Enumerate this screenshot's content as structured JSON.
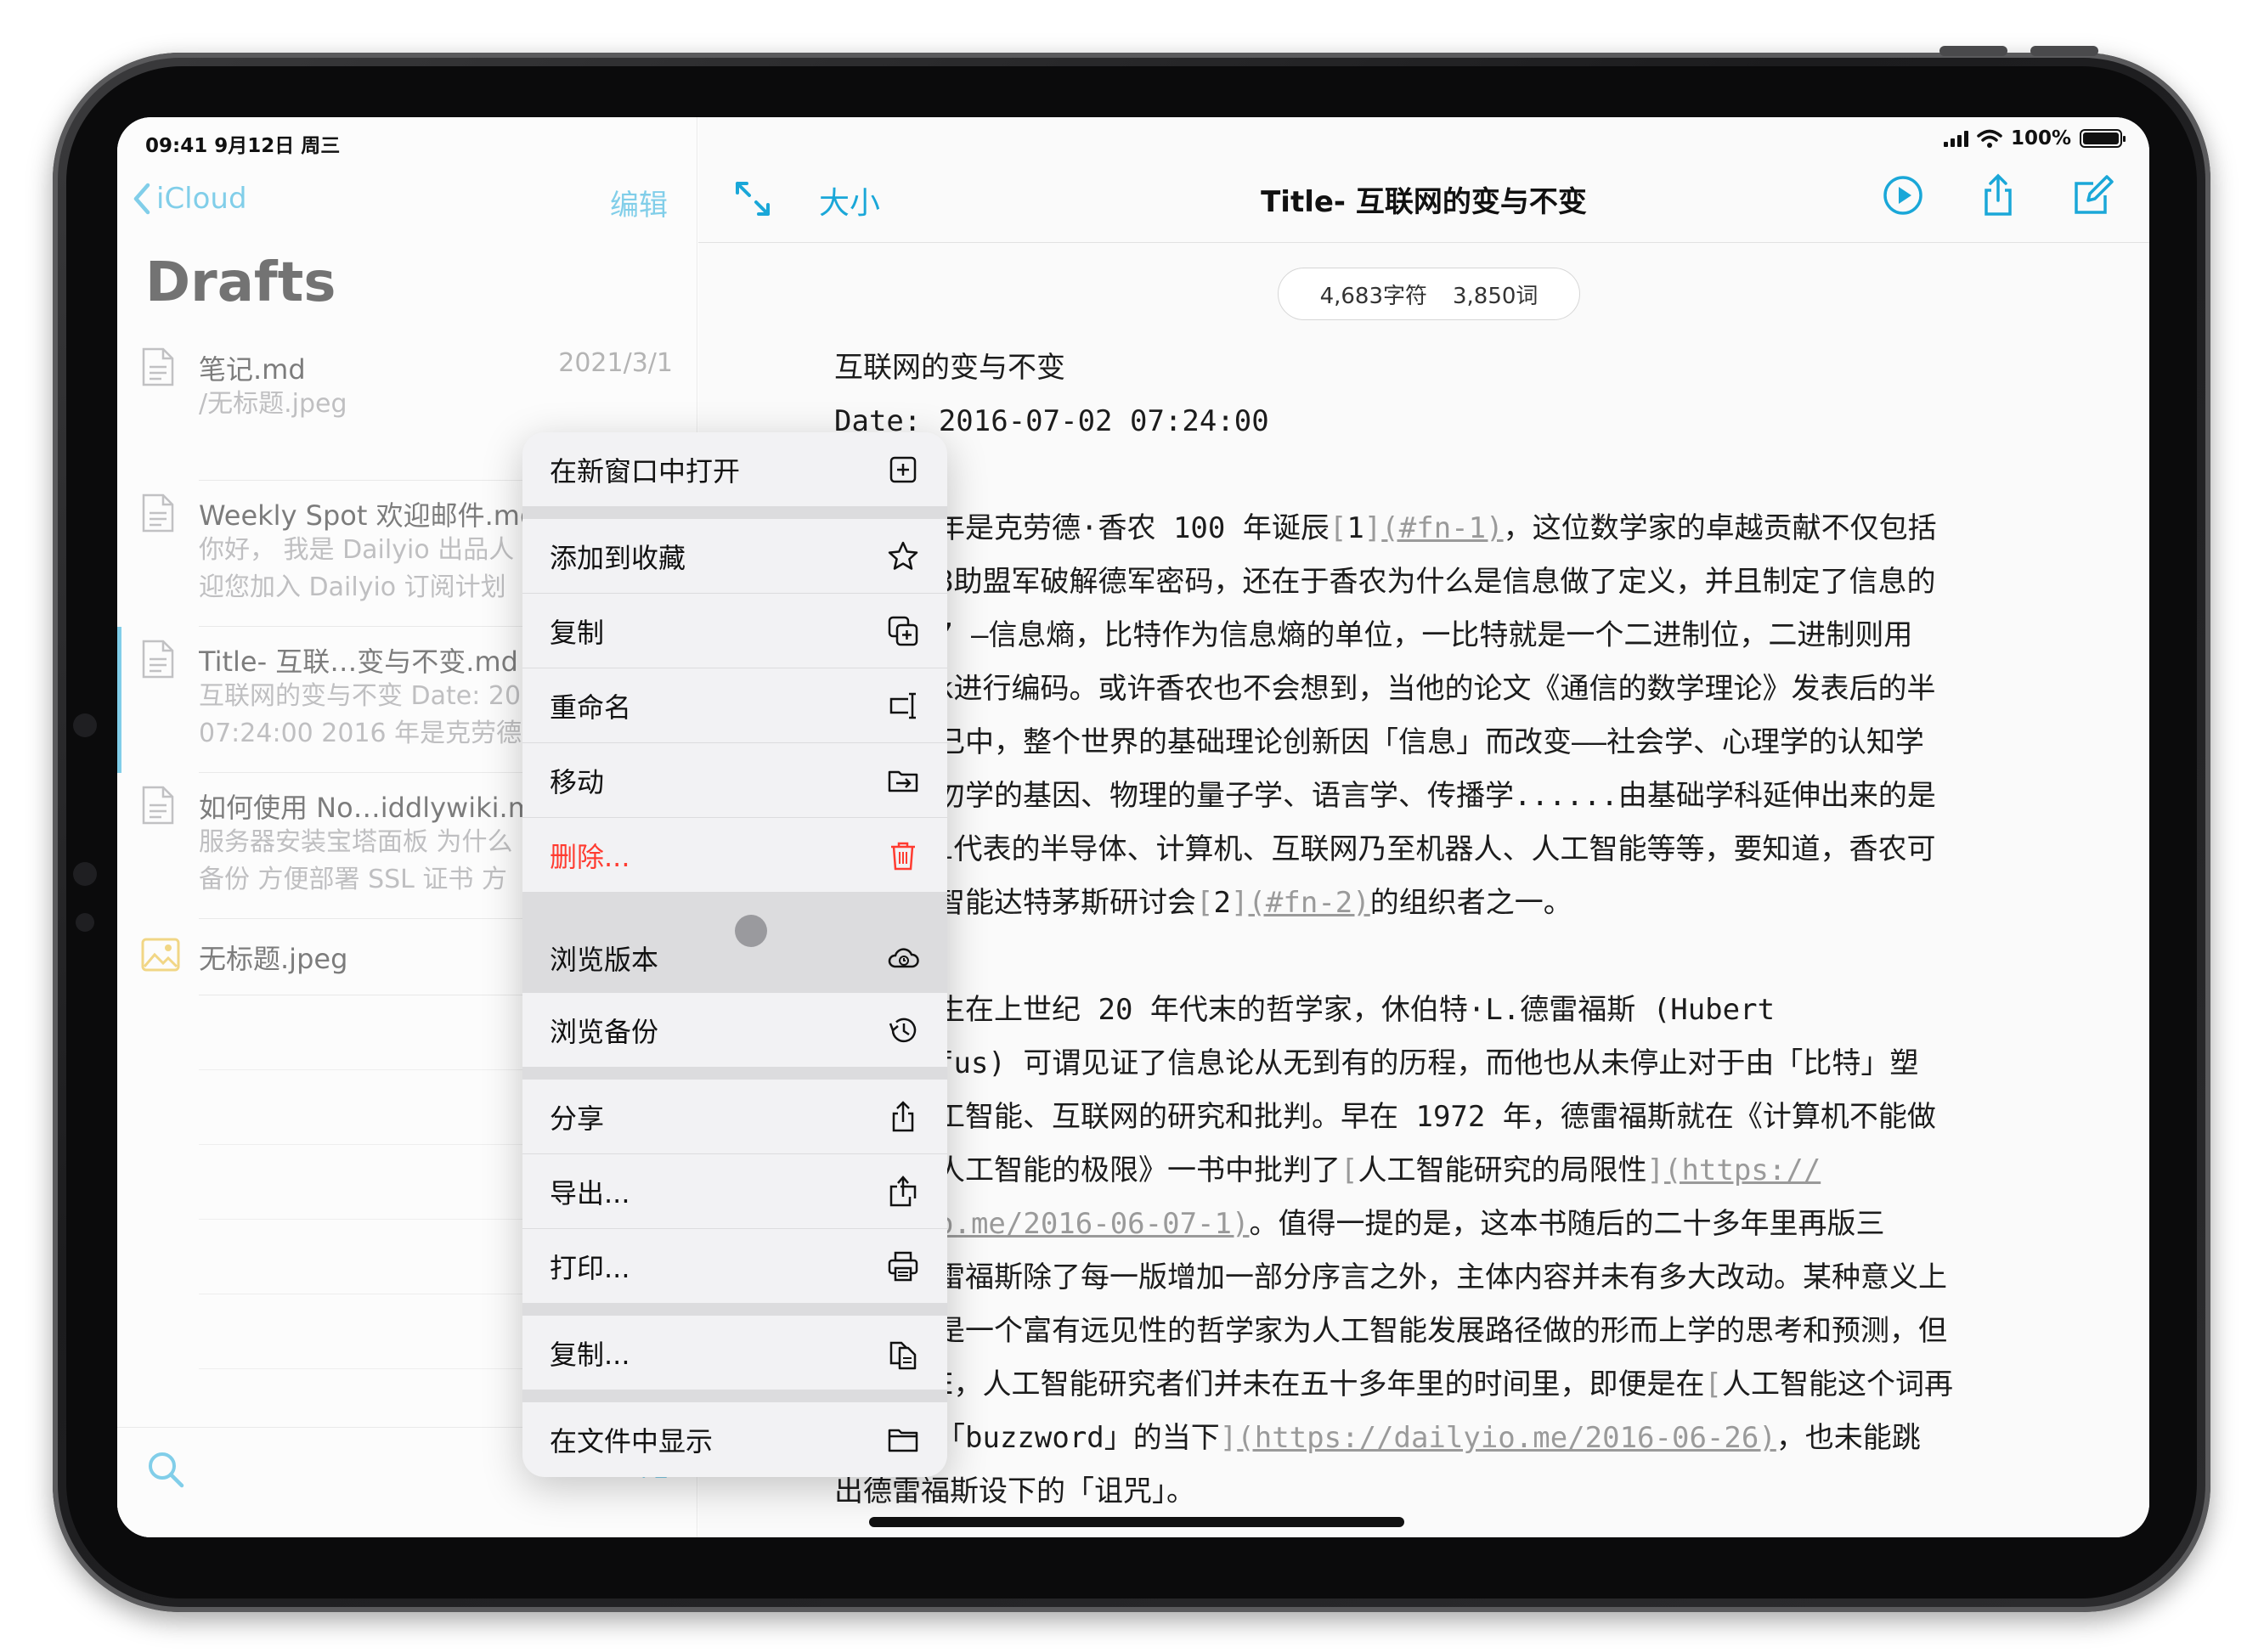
{
  "status": {
    "time": "09:41  9月12日 周三",
    "battery": "100%"
  },
  "sidebar": {
    "back_label": "iCloud",
    "edit_label": "编辑",
    "title": "Drafts",
    "files": [
      {
        "name": "笔记.md",
        "date": "2021/3/1",
        "line1": "/无标题.jpeg",
        "line2": "",
        "icon": "document-icon"
      },
      {
        "name": "Weekly Spot 欢迎邮件.md",
        "date": "",
        "line1": "你好，  我是 Dailyio 出品人",
        "line2": "迎您加入 Dailyio 订阅计划",
        "icon": "document-icon"
      },
      {
        "name": "Title- 互联…变与不变.md",
        "date": "",
        "line1": "互联网的变与不变 Date: 20",
        "line2": "07:24:00 2016 年是克劳德",
        "icon": "document-icon"
      },
      {
        "name": "如何使用 No…iddlywiki.md",
        "date": "",
        "line1": "服务器安装宝塔面板 为什么",
        "line2": "备份 方便部署 SSL 证书 方",
        "icon": "document-icon"
      },
      {
        "name": "无标题.jpeg",
        "date": "",
        "line1": "",
        "line2": "",
        "icon": "image-icon"
      }
    ],
    "sort_label": "↓z"
  },
  "editor": {
    "size_label": "大小",
    "title": "Title- 互联网的变与不变",
    "char_count": "4,683字符",
    "word_count": "3,850词",
    "doc_title": "互联网的变与不变",
    "date_line": "Date: 2016-07-02 07:24:00",
    "p1": [
      "年是克劳德·香农 100 年诞辰",
      "1",
      "(#fn-1)",
      "，这位数学家的卓越贡献不仅包括",
      "8助盟军破解德军密码，还在于香农为什么是信息做了定义，并且制定了信息的",
      "” —信息熵，比特作为信息熵的单位，一比特就是一个二进制位，二进制则用",
      "k进行编码。或许香农也不会想到，当他的论文《通信的数学理论》发表后的半",
      "己中，整个世界的基础理论创新因「信息」而改变——社会学、心理学的认知学",
      "勿学的基因、物理的量子学、语言学、传播学......由基础学科延伸出来的是",
      "i代表的半导体、计算机、互联网乃至机器人、人工智能等等，要知道，香农可",
      "智能达特茅斯研讨会",
      "2",
      "(#fn-2)",
      "的组织者之一。"
    ],
    "p2": [
      "生在上世纪 20 年代末的哲学家，休伯特·L.德雷福斯 (Hubert",
      "fus) 可谓见证了信息论从无到有的历程，而他也从未停止对于由「比特」塑",
      "工智能、互联网的研究和批判。早在 1972 年，德雷福斯就在《计算机不能做",
      "人工智能的极限》一书中批判了",
      "人工智能研究的局限性",
      "(https://",
      "o.me/2016-06-07-1)",
      "。值得一提的是，这本书随后的二十多年里再版三",
      "雷福斯除了每一版增加一部分序言之外，主体内容并未有多大改动。某种意义上",
      "是一个富有远见性的哲学家为人工智能发展路径做的形而上学的思考和预测，但",
      "E，人工智能研究者们并未在五十多年里的时间里，即便是在",
      "人工智能这个词再",
      "「buzzword」的当下",
      "(https://dailyio.me/2016-06-26)",
      "，也未能跳",
      "出德雷福斯设下的「诅咒」。"
    ]
  },
  "context_menu": {
    "items": [
      {
        "label": "在新窗口中打开",
        "icon": "new-window-icon"
      },
      {
        "label": "添加到收藏",
        "icon": "star-icon"
      },
      {
        "label": "复制",
        "icon": "duplicate-icon"
      },
      {
        "label": "重命名",
        "icon": "rename-icon"
      },
      {
        "label": "移动",
        "icon": "move-folder-icon"
      },
      {
        "label": "删除...",
        "icon": "trash-icon"
      },
      {
        "label": "浏览版本",
        "icon": "cloud-versions-icon"
      },
      {
        "label": "浏览备份",
        "icon": "history-icon"
      },
      {
        "label": "分享",
        "icon": "share-icon"
      },
      {
        "label": "导出...",
        "icon": "export-icon"
      },
      {
        "label": "打印...",
        "icon": "print-icon"
      },
      {
        "label": "复制...",
        "icon": "copy-docs-icon"
      },
      {
        "label": "在文件中显示",
        "icon": "folder-icon"
      }
    ]
  },
  "colors": {
    "accent": "#1aa7d8",
    "danger": "#ff3b30",
    "link_gray": "#9a9a9a"
  }
}
